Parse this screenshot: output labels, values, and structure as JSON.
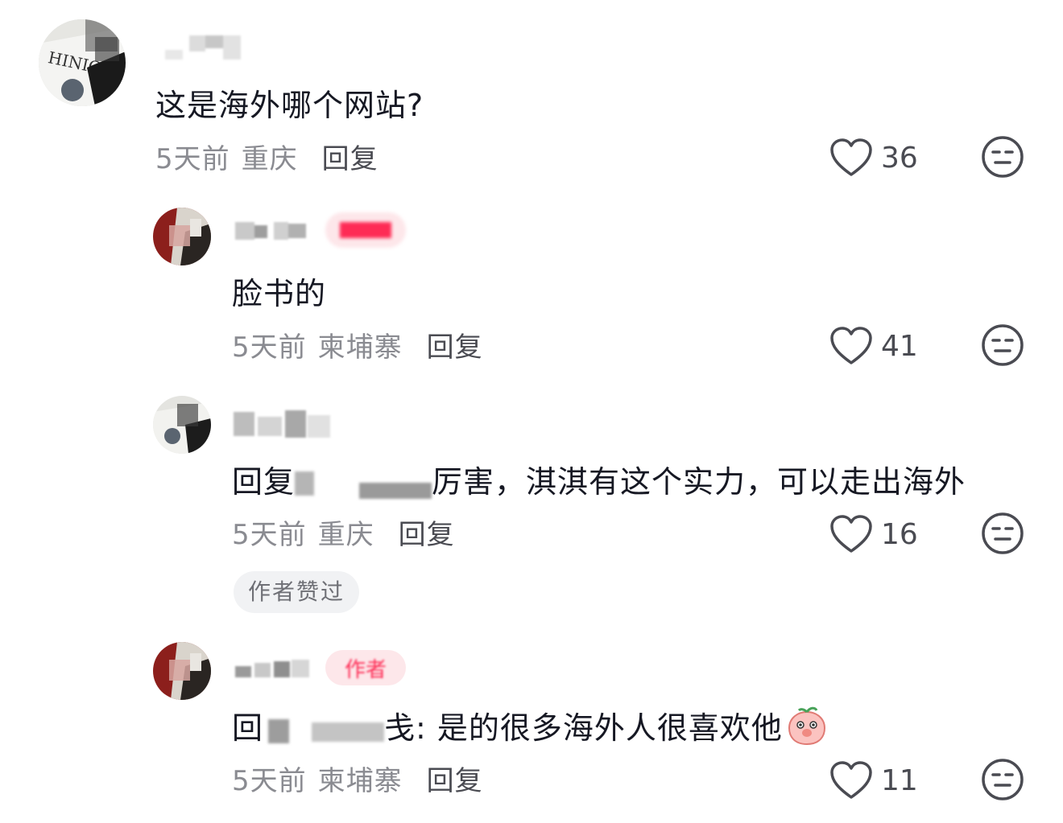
{
  "comments": [
    {
      "text": "这是海外哪个网站?",
      "time": "5天前",
      "location": "重庆",
      "reply_label": "回复",
      "likes": "36"
    },
    {
      "text": "脸书的",
      "time": "5天前",
      "location": "柬埔寨",
      "reply_label": "回复",
      "likes": "41"
    },
    {
      "text_prefix": "回复",
      "text_suffix": "厉害，淇淇有这个实力，可以走出海外",
      "time": "5天前",
      "location": "重庆",
      "reply_label": "回复",
      "likes": "16",
      "badge": "作者赞过"
    },
    {
      "text_prefix": "回",
      "text_suffix": "戋: 是的很多海外人很喜欢他",
      "time": "5天前",
      "location": "柬埔寨",
      "reply_label": "回复",
      "likes": "11",
      "author_tag": "作者"
    }
  ],
  "icons": {
    "like": "heart-outline-icon",
    "dislike": "meh-face-icon",
    "emoji": "peach-emoji"
  },
  "colors": {
    "text": "#161823",
    "meta": "#8a8b91",
    "icon": "#4a4b52",
    "author_tag_bg": "#fde7ea",
    "author_tag_fg": "#fe2c55"
  }
}
